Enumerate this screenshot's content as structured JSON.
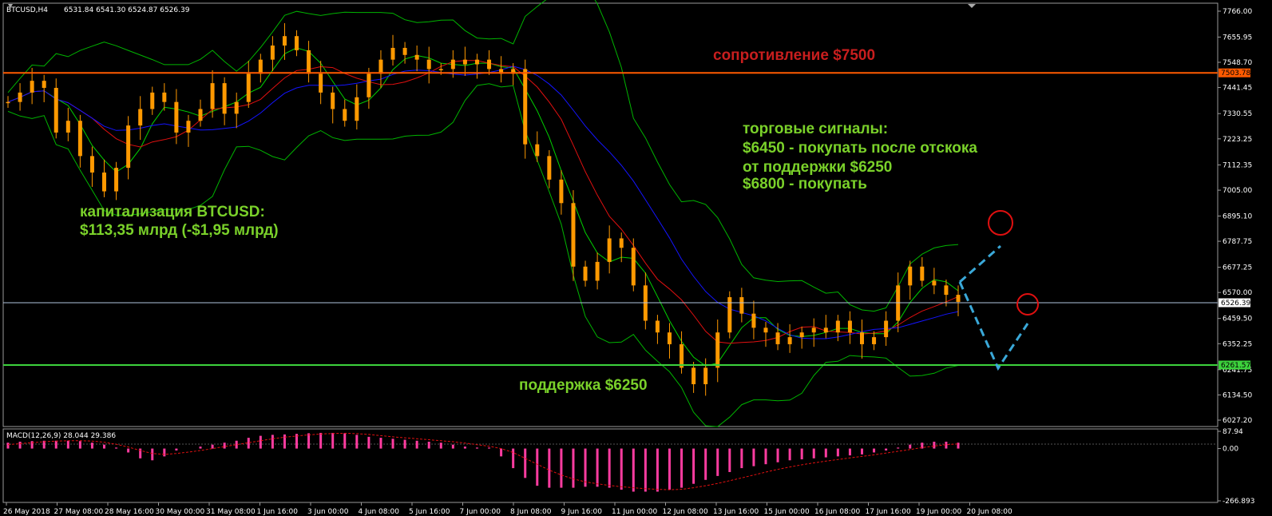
{
  "header": {
    "symbol": "BTCUSD,H4",
    "ohlc": "6531.84 6541.30 6524.87 6526.39",
    "macd_label": "MACD(12,26,9) 28.044 29.386"
  },
  "colors": {
    "background": "#000000",
    "candle": "#ff9900",
    "bollinger": "#00b400",
    "ma_fast": "#00d000",
    "ma_red": "#e01010",
    "ma_blue": "#1414ff",
    "resistance": "#ff5a00",
    "support": "#3cd23c",
    "macd_hist": "#ff3ca0",
    "macd_signal": "#e01010",
    "annotation_red": "#c81e1e",
    "annotation_green": "#7ad12a",
    "forecast": "#3aa8d8",
    "target_circle": "#e01010"
  },
  "annotations": {
    "resistance": "сопротивление $7500",
    "signals_1": "торговые сигналы:",
    "signals_2": "$6450 - покупать после отскока",
    "signals_3": "от поддержки $6250",
    "signals_4": "$6800 - покупать",
    "cap_1": "капитализация BTCUSD:",
    "cap_2": "$113,35 млрд (-$1,95 млрд)",
    "support": "поддержка $6250"
  },
  "chart_data": {
    "type": "candlestick",
    "symbol": "BTCUSD",
    "timeframe": "H4",
    "ylim": [
      6000,
      7800
    ],
    "y_ticks": [
      "7766.00",
      "7655.95",
      "7548.70",
      "7441.45",
      "7330.55",
      "7223.25",
      "7112.35",
      "7005.00",
      "6895.10",
      "6787.75",
      "6677.25",
      "6570.00",
      "6459.50",
      "6352.25",
      "6241.75",
      "6134.50",
      "6027.20"
    ],
    "x_ticks": [
      "26 May 2018",
      "27 May 08:00",
      "28 May 16:00",
      "30 May 00:00",
      "31 May 08:00",
      "1 Jun 16:00",
      "3 Jun 00:00",
      "4 Jun 08:00",
      "5 Jun 16:00",
      "7 Jun 00:00",
      "8 Jun 08:00",
      "9 Jun 16:00",
      "11 Jun 00:00",
      "12 Jun 08:00",
      "13 Jun 16:00",
      "15 Jun 00:00",
      "16 Jun 08:00",
      "17 Jun 16:00",
      "19 Jun 00:00",
      "20 Jun 08:00"
    ],
    "resistance": {
      "value": 7503.78,
      "label": "7503.78"
    },
    "current_price": {
      "value": 6526.39,
      "label": "6526.39"
    },
    "support": {
      "value": 6261.57,
      "label": "6261.57"
    },
    "close_path": [
      7380,
      7420,
      7470,
      7440,
      7250,
      7300,
      7150,
      7080,
      7000,
      7100,
      7280,
      7350,
      7420,
      7380,
      7250,
      7300,
      7350,
      7460,
      7330,
      7380,
      7500,
      7560,
      7620,
      7660,
      7600,
      7500,
      7420,
      7350,
      7300,
      7400,
      7500,
      7560,
      7610,
      7580,
      7560,
      7520,
      7520,
      7560,
      7540,
      7560,
      7520,
      7500,
      7520,
      7200,
      7150,
      7050,
      6950,
      6680,
      6620,
      6700,
      6800,
      6760,
      6600,
      6450,
      6400,
      6350,
      6250,
      6180,
      6250,
      6400,
      6550,
      6480,
      6420,
      6400,
      6350,
      6380,
      6400,
      6420,
      6400,
      6450,
      6400,
      6350,
      6380,
      6450,
      6600,
      6680,
      6620,
      6600,
      6560,
      6530
    ],
    "macd": {
      "ylim": [
        -266.893,
        87.94
      ],
      "y_ticks": [
        "87.94",
        "0.00",
        "-266.893"
      ],
      "histogram_path": [
        30,
        35,
        38,
        40,
        40,
        40,
        38,
        30,
        20,
        5,
        -20,
        -50,
        -60,
        -40,
        -10,
        0,
        10,
        20,
        30,
        40,
        55,
        65,
        70,
        72,
        75,
        78,
        80,
        80,
        78,
        70,
        60,
        55,
        50,
        45,
        40,
        35,
        30,
        20,
        10,
        5,
        5,
        -40,
        -100,
        -150,
        -190,
        -200,
        -200,
        -200,
        -195,
        -195,
        -200,
        -210,
        -220,
        -220,
        -220,
        -210,
        -200,
        -180,
        -160,
        -140,
        -120,
        -100,
        -90,
        -80,
        -70,
        -60,
        -55,
        -50,
        -45,
        -40,
        -35,
        -30,
        -20,
        -10,
        5,
        20,
        30,
        35,
        35,
        30
      ],
      "signal_path": [
        20,
        25,
        30,
        35,
        38,
        40,
        40,
        38,
        32,
        22,
        8,
        -10,
        -25,
        -30,
        -25,
        -18,
        -10,
        0,
        10,
        20,
        30,
        40,
        50,
        58,
        64,
        70,
        74,
        77,
        78,
        76,
        72,
        66,
        60,
        55,
        50,
        45,
        40,
        35,
        28,
        20,
        12,
        0,
        -20,
        -50,
        -80,
        -110,
        -135,
        -155,
        -170,
        -180,
        -188,
        -195,
        -200,
        -205,
        -208,
        -210,
        -208,
        -200,
        -190,
        -178,
        -164,
        -150,
        -135,
        -120,
        -106,
        -94,
        -83,
        -73,
        -64,
        -56,
        -48,
        -40,
        -32,
        -23,
        -14,
        -5,
        5,
        13,
        20,
        24
      ]
    }
  }
}
